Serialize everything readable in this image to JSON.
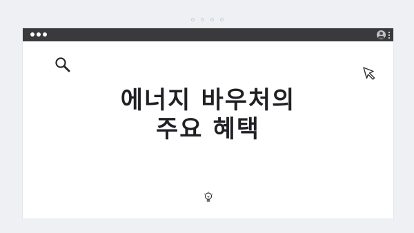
{
  "pager": {
    "dots": [
      "page-dot-1",
      "page-dot-2",
      "page-dot-3",
      "page-dot-4"
    ]
  },
  "window": {
    "titlebar": {
      "controls_icon": "three-dot-controls-icon",
      "user_icon": "user-icon",
      "menu_icon": "vertical-ellipsis-icon"
    },
    "icons": {
      "top_left": "search-icon",
      "top_right": "cursor-pointer-icon",
      "bottom": "lightbulb-icon"
    }
  },
  "headline": {
    "line1": "에너지 바우처의",
    "line2": "주요 혜택"
  },
  "colors": {
    "background": "#eef0f4",
    "titlebar": "#3a3a3c",
    "card": "#ffffff",
    "text": "#1f1f24"
  }
}
